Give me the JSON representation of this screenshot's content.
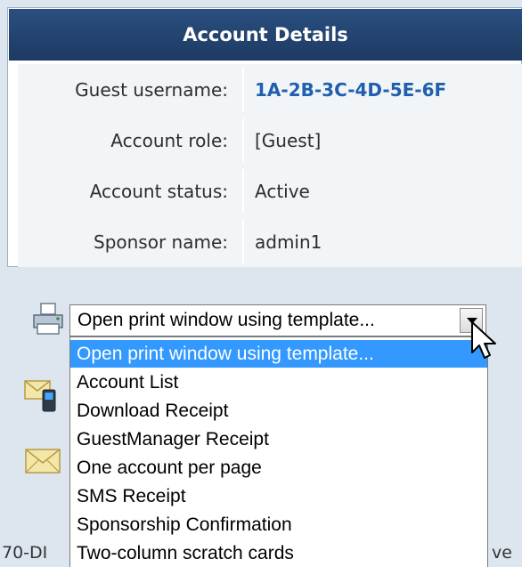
{
  "account_details": {
    "title": "Account Details",
    "rows": [
      {
        "label": "Guest username:",
        "value": "1A-2B-3C-4D-5E-6F"
      },
      {
        "label": "Account role:",
        "value": "[Guest]"
      },
      {
        "label": "Account status:",
        "value": "Active"
      },
      {
        "label": "Sponsor name:",
        "value": "admin1"
      }
    ]
  },
  "print": {
    "icon": "printer-icon",
    "selected": "Open print window using template...",
    "options": [
      "Open print window using template...",
      "Account List",
      "Download Receipt",
      "GuestManager Receipt",
      "One account per page",
      "SMS Receipt",
      "Sponsorship Confirmation",
      "Two-column scratch cards"
    ]
  },
  "footer": {
    "left_text": "70-DI",
    "right_text": "ve"
  },
  "colors": {
    "header": "#1d3a63",
    "link": "#1f5fae",
    "highlight": "#3399ff",
    "panel": "#dde6ef"
  }
}
